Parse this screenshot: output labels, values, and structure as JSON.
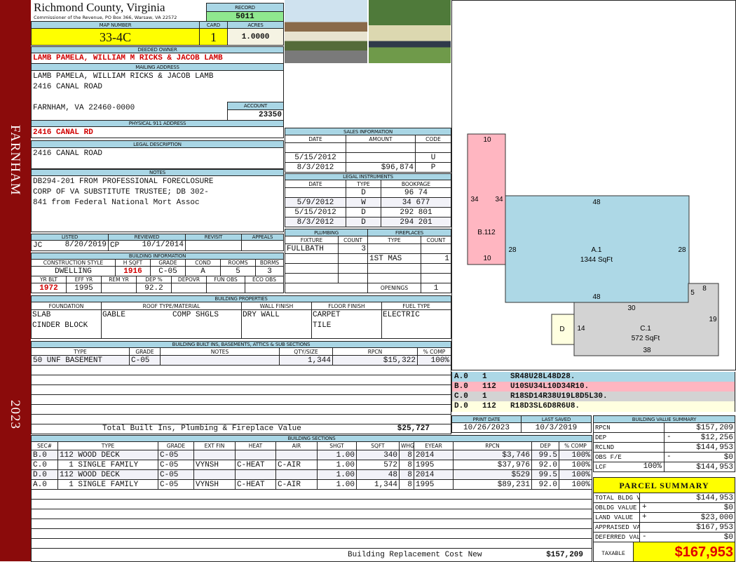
{
  "side": {
    "district": "FARNHAM",
    "year": "2023"
  },
  "header": {
    "county": "Richmond County, Virginia",
    "subtitle": "Commissioner of the Revenue, PO Box 366, Warsaw, VA 22572",
    "record_label": "RECORD",
    "record": "5011",
    "map_label": "MAP NUMBER",
    "map": "33-4C",
    "card_label": "CARD",
    "card": "1",
    "acres_label": "ACRES",
    "acres": "1.0000"
  },
  "owner": {
    "label": "DEEDED OWNER",
    "value": "LAMB PAMELA, WILLIAM M RICKS & JACOB LAMB"
  },
  "mailing": {
    "label": "MAILING ADDRESS",
    "lines": [
      "LAMB PAMELA, WILLIAM RICKS & JACOB LAMB",
      "2416 CANAL ROAD",
      "FARNHAM, VA 22460-0000"
    ],
    "account_label": "ACCOUNT",
    "account": "23350"
  },
  "physical": {
    "label": "PHYSICAL 911 ADDRESS",
    "value": "2416 CANAL RD"
  },
  "legal": {
    "label": "LEGAL DESCRIPTION",
    "value": "2416 CANAL ROAD"
  },
  "notes": {
    "label": "NOTES",
    "lines": [
      "DB294-201 FROM PROFESSIONAL FORECLOSURE",
      "CORP OF VA SUBSTITUTE TRUSTEE; DB 302-",
      "841 from Federal National Mort Assoc"
    ]
  },
  "review": {
    "labels": [
      "LISTED",
      "REVIEWED",
      "REVISIT",
      "APPEALS"
    ],
    "listed_by": "JC",
    "listed_date": "8/20/2019",
    "reviewed_by": "CP",
    "reviewed_date": "10/1/2014"
  },
  "building_info": {
    "title": "BUILDING INFORMATION",
    "headers1": [
      "CONSTRUCTION STYLE",
      "H SQFT",
      "GRADE",
      "COND",
      "ROOMS",
      "BDRMS"
    ],
    "values1": [
      "DWELLING",
      "1916",
      "C-05",
      "A",
      "5",
      "3"
    ],
    "headers2": [
      "YR BLT",
      "EFF YR",
      "REM YR",
      "DEP %",
      "DEPOVR",
      "FUN OBS",
      "ECO OBS"
    ],
    "values2": [
      "1972",
      "1995",
      "",
      "92.2",
      "",
      "",
      ""
    ]
  },
  "sales": {
    "title": "SALES INFORMATION",
    "headers": [
      "DATE",
      "AMOUNT",
      "CODE"
    ],
    "rows": [
      [
        "",
        "",
        ""
      ],
      [
        "5/15/2012",
        "",
        "U"
      ],
      [
        "8/3/2012",
        "$96,874",
        "P"
      ]
    ]
  },
  "legal_instruments": {
    "title": "LEGAL INSTRUMENTS",
    "headers": [
      "DATE",
      "TYPE",
      "BOOKPAGE"
    ],
    "rows": [
      [
        "",
        "D",
        "96 74"
      ],
      [
        "5/9/2012",
        "W",
        "34 677"
      ],
      [
        "5/15/2012",
        "D",
        "292 801"
      ],
      [
        "8/3/2012",
        "D",
        "294 201"
      ]
    ]
  },
  "plumbing": {
    "title": "PLUMBING",
    "headers": [
      "FIXTURE",
      "COUNT"
    ],
    "rows": [
      [
        "FULLBATH",
        "3"
      ],
      [
        "",
        ""
      ],
      [
        "",
        ""
      ],
      [
        "",
        ""
      ]
    ]
  },
  "fireplaces": {
    "title": "FIREPLACES",
    "headers": [
      "TYPE",
      "COUNT"
    ],
    "rows": [
      [
        "",
        ""
      ],
      [
        "1ST MAS",
        "1"
      ],
      [
        "",
        ""
      ],
      [
        "",
        ""
      ]
    ],
    "openings_label": "OPENINGS",
    "openings": "1"
  },
  "properties": {
    "title": "BUILDING PROPERTIES",
    "headers": [
      "FOUNDATION",
      "ROOF TYPE/MATERIAL",
      "WALL FINISH",
      "FLOOR FINISH",
      "FUEL TYPE"
    ],
    "foundation": [
      "SLAB",
      "CINDER BLOCK"
    ],
    "roof_type": "GABLE",
    "roof_material": "COMP SHGLS",
    "wall": "DRY WALL",
    "floor": [
      "CARPET",
      "TILE"
    ],
    "fuel": "ELECTRIC"
  },
  "built_ins": {
    "title": "BUILDING BUILT INS, BASEMENTS, ATTICS & SUB SECTIONS",
    "headers": [
      "TYPE",
      "GRADE",
      "NOTES",
      "QTY/SIZE",
      "RPCN",
      "% COMP"
    ],
    "rows": [
      [
        "50 UNF BASEMENT",
        "C-05",
        "",
        "1,344",
        "$15,322",
        "100%"
      ]
    ],
    "total_label": "Total Built Ins, Plumbing & Fireplace Value",
    "total": "$25,727"
  },
  "sections": {
    "title": "BUILDING SECTIONS",
    "headers": [
      "SEC#",
      "TYPE",
      "GRADE",
      "EXT FIN",
      "HEAT",
      "AIR",
      "SHGT",
      "SQFT",
      "WHGT",
      "EYEAR",
      "RPCN",
      "DEP",
      "% COMP"
    ],
    "rows": [
      [
        "B.0",
        "112 WOOD DECK",
        "C-05",
        "",
        "",
        "",
        "1.00",
        "340",
        "8",
        "2014",
        "$3,746",
        "99.5",
        "100%"
      ],
      [
        "C.0",
        "  1 SINGLE FAMILY",
        "C-05",
        "VYNSH",
        "C-HEAT",
        "C-AIR",
        "1.00",
        "572",
        "8",
        "1995",
        "$37,976",
        "92.0",
        "100%"
      ],
      [
        "D.0",
        "112 WOOD DECK",
        "C-05",
        "",
        "",
        "",
        "1.00",
        "48",
        "8",
        "2014",
        "$529",
        "99.5",
        "100%"
      ],
      [
        "A.0",
        "  1 SINGLE FAMILY",
        "C-05",
        "VYNSH",
        "C-HEAT",
        "C-AIR",
        "1.00",
        "1,344",
        "8",
        "1995",
        "$89,231",
        "92.0",
        "100%"
      ]
    ],
    "total_label": "Building Replacement Cost New",
    "total": "$157,209"
  },
  "dates": {
    "headers": [
      "PRINT DATE",
      "LAST SAVED"
    ],
    "values": [
      "10/26/2023",
      "10/3/2019"
    ]
  },
  "value_summary": {
    "title": "BUILDING VALUE SUMMARY",
    "rows": [
      {
        "label": "RPCN",
        "pct": "",
        "sign": "",
        "value": "$157,209"
      },
      {
        "label": "DEP",
        "pct": "",
        "sign": "-",
        "value": "$12,256"
      },
      {
        "label": "RCLND",
        "pct": "",
        "sign": "",
        "value": "$144,953"
      },
      {
        "label": "OBS F/E",
        "pct": "",
        "sign": "-",
        "value": "$0"
      },
      {
        "label": "LCF",
        "pct": "100%",
        "sign": "",
        "value": "$144,953"
      }
    ]
  },
  "parcel": {
    "title": "PARCEL SUMMARY",
    "rows": [
      {
        "label": "TOTAL BLDG VALUE",
        "sign": "",
        "value": "$144,953"
      },
      {
        "label": "OBLDG VALUE",
        "sign": "+",
        "value": "$0"
      },
      {
        "label": "LAND VALUE",
        "sign": "+",
        "value": "$23,000"
      },
      {
        "label": "APPRAISED VALUE",
        "sign": "",
        "value": "$167,953"
      },
      {
        "label": "DEFERRED VALUE",
        "sign": "-",
        "value": "$0"
      }
    ],
    "taxable_label": "TAXABLE\nVALUE",
    "taxable": "$167,953"
  },
  "sketch": {
    "colors": {
      "A": "#add8e6",
      "B": "#ffb6c1",
      "C": "#d3d3d3",
      "D": "#ffffe0"
    },
    "codes": [
      {
        "sec": "A.0",
        "num": "1",
        "code": "SR48U28L48D28."
      },
      {
        "sec": "B.0",
        "num": "112",
        "code": "U10SU34L10D34R10."
      },
      {
        "sec": "C.0",
        "num": "1",
        "code": "R18SD14R38U19L8D5L30."
      },
      {
        "sec": "D.0",
        "num": "112",
        "code": "R18D3SL6D8R6U8."
      }
    ],
    "labels": {
      "A_name": "A.1",
      "A_area": "1344 SqFt",
      "A_top": "48",
      "A_bottom": "48",
      "A_left": "28",
      "A_right": "28",
      "B_name": "B.112",
      "B_top": "10",
      "B_bottom": "10",
      "B_left": "34",
      "B_right": "34",
      "C_name": "C.1",
      "C_area": "572 SqFt",
      "C_top": "30",
      "C_left": "14",
      "C_bottom": "38",
      "C_right": "19",
      "C_step": "5",
      "C_notch": "8",
      "D_name": "D"
    }
  }
}
